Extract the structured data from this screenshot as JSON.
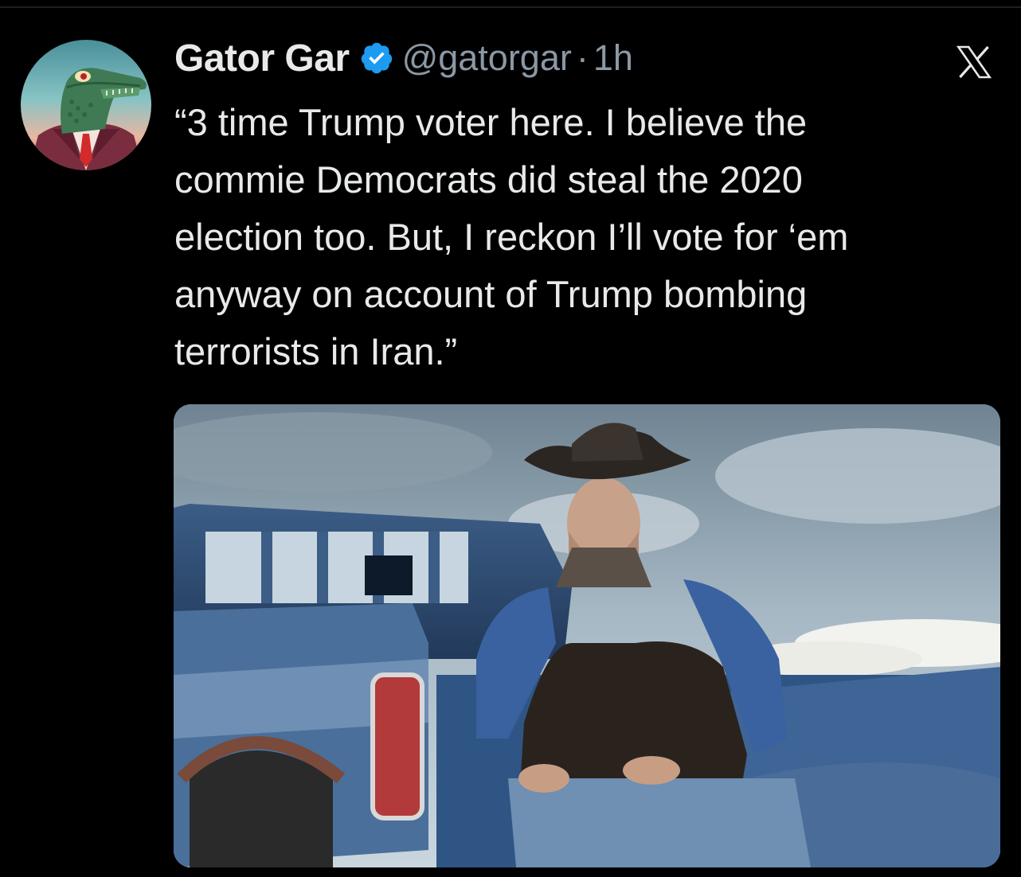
{
  "tweet": {
    "display_name": "Gator Gar",
    "handle": "@gatorgar",
    "separator": "·",
    "time": "1h",
    "text_lines": [
      "“3 time Trump voter here. I believe the",
      "commie Democrats did steal the 2020",
      "election too. But, I reckon I’ll vote for ‘em",
      "anyway on account of Trump bombing",
      "terrorists in Iran.”"
    ]
  },
  "icons": {
    "verified": "verified-badge-icon",
    "platform": "x-logo-icon"
  },
  "colors": {
    "background": "#000000",
    "text": "#e7e9ea",
    "secondary_text": "#8b98a5",
    "verified_blue": "#1d9bf0"
  }
}
